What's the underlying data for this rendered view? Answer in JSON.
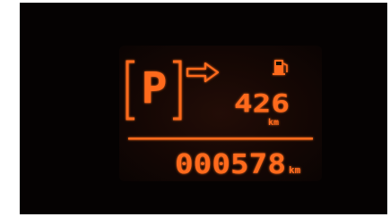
{
  "display": {
    "gear": "P",
    "fuel_range": "426",
    "fuel_range_unit": "km",
    "odometer": "000578",
    "odometer_unit": "km"
  },
  "colors": {
    "segment_on": "#ff6a1f",
    "segment_glow": "#ff3a00",
    "lcd_background": "#150704",
    "bezel": "#050202"
  },
  "icons": {
    "gear_box": "parking-gear-indicator",
    "shift_arrow": "arrow-right-icon",
    "fuel": "fuel-pump-icon"
  }
}
